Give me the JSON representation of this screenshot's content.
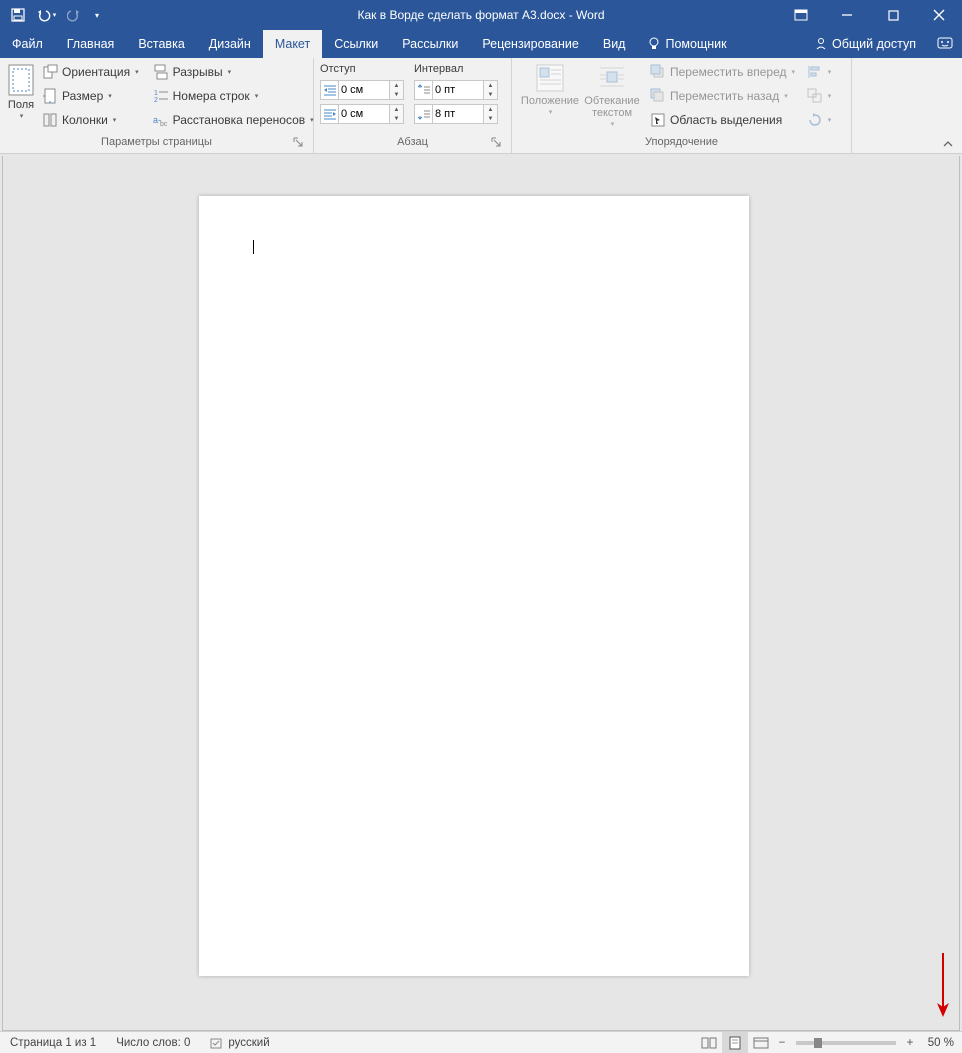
{
  "title": "Как в Ворде сделать формат А3.docx - Word",
  "tabs": {
    "file": "Файл",
    "home": "Главная",
    "insert": "Вставка",
    "design": "Дизайн",
    "layout": "Макет",
    "references": "Ссылки",
    "mailings": "Рассылки",
    "review": "Рецензирование",
    "view": "Вид",
    "tellme": "Помощник",
    "share": "Общий доступ"
  },
  "ribbon": {
    "page_setup": {
      "margins": "Поля",
      "orientation": "Ориентация",
      "size": "Размер",
      "columns": "Колонки",
      "breaks": "Разрывы",
      "line_numbers": "Номера строк",
      "hyphenation": "Расстановка переносов",
      "label": "Параметры страницы"
    },
    "paragraph": {
      "indent_label": "Отступ",
      "spacing_label": "Интервал",
      "indent_left": "0 см",
      "indent_right": "0 см",
      "space_before": "0 пт",
      "space_after": "8 пт",
      "label": "Абзац"
    },
    "arrange": {
      "position": "Положение",
      "wrap": "Обтекание текстом",
      "bring_forward": "Переместить вперед",
      "send_backward": "Переместить назад",
      "selection_pane": "Область выделения",
      "label": "Упорядочение"
    }
  },
  "status": {
    "page": "Страница 1 из 1",
    "words": "Число слов: 0",
    "language": "русский",
    "zoom": "50 %"
  }
}
